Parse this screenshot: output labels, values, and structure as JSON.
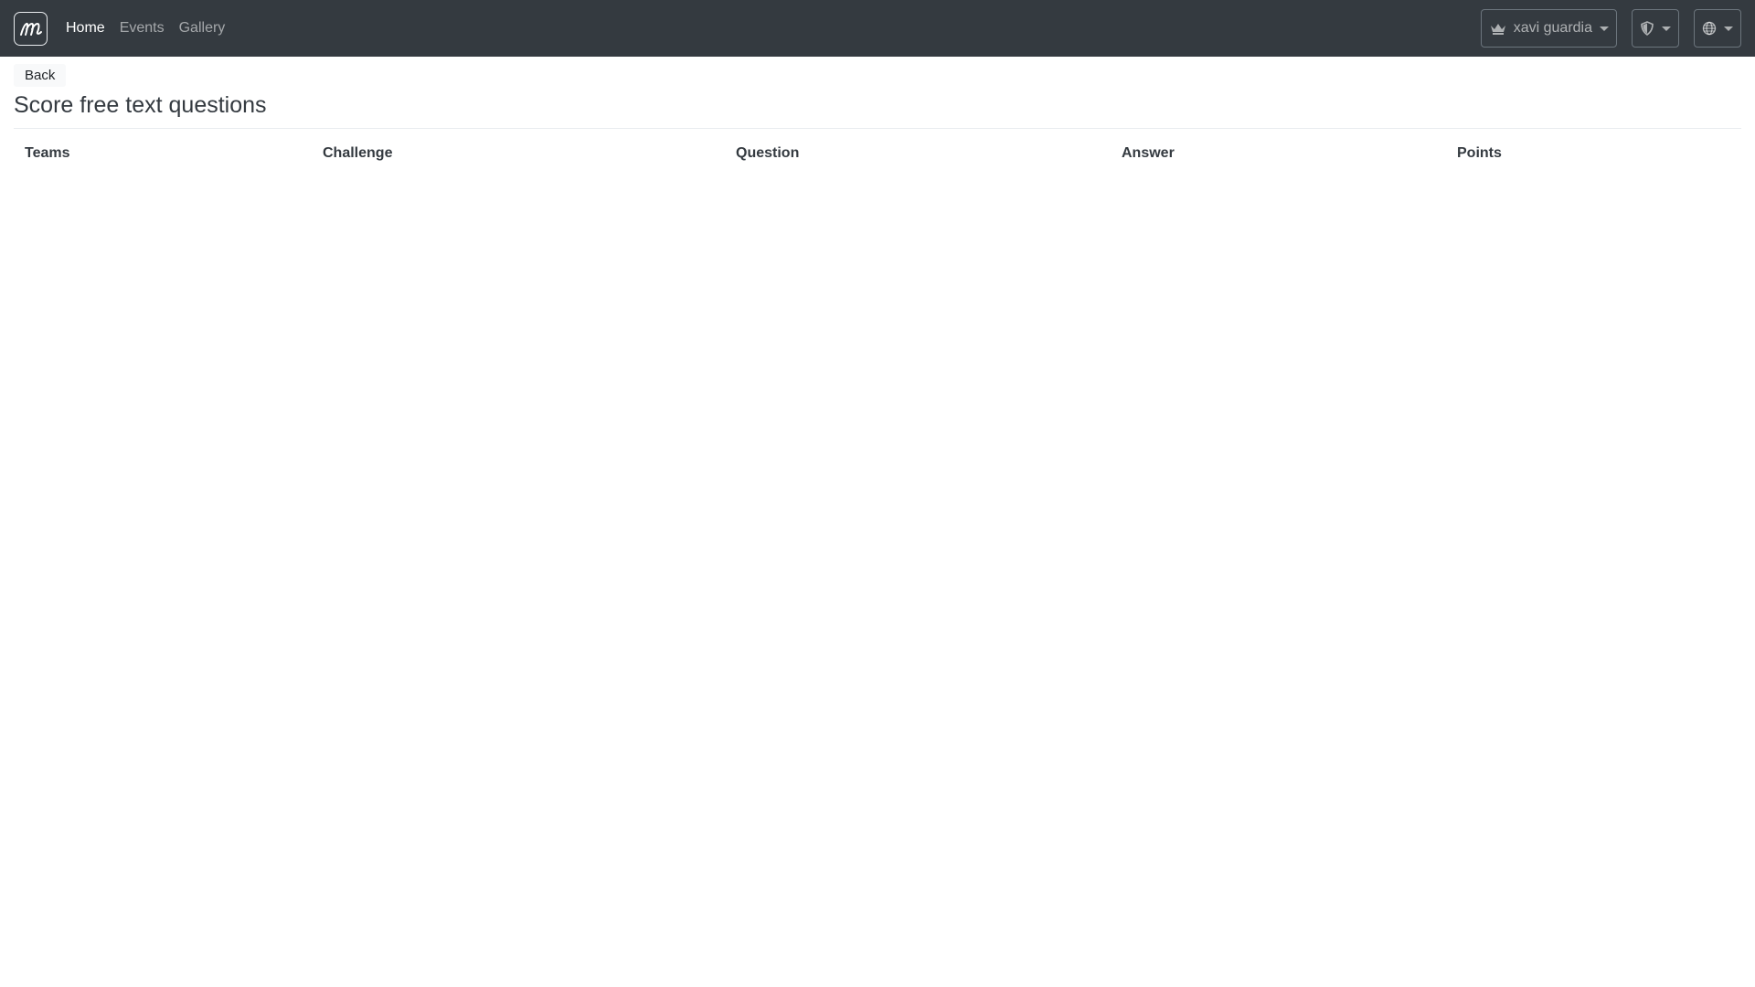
{
  "navbar": {
    "brand_icon": "script-m-logo-icon",
    "links": [
      {
        "label": "Home",
        "active": true
      },
      {
        "label": "Events",
        "active": false
      },
      {
        "label": "Gallery",
        "active": false
      }
    ],
    "user_menu": {
      "icon": "crown-icon",
      "label": "xavi guardia"
    },
    "admin_menu": {
      "icon": "shield-icon"
    },
    "language_menu": {
      "icon": "globe-icon"
    }
  },
  "page": {
    "back_label": "Back",
    "title": "Score free text questions"
  },
  "table": {
    "headers": [
      "Teams",
      "Challenge",
      "Question",
      "Answer",
      "Points"
    ],
    "rows": []
  },
  "colors": {
    "navbar_bg": "#343a40",
    "page_bg": "#ffffff"
  }
}
